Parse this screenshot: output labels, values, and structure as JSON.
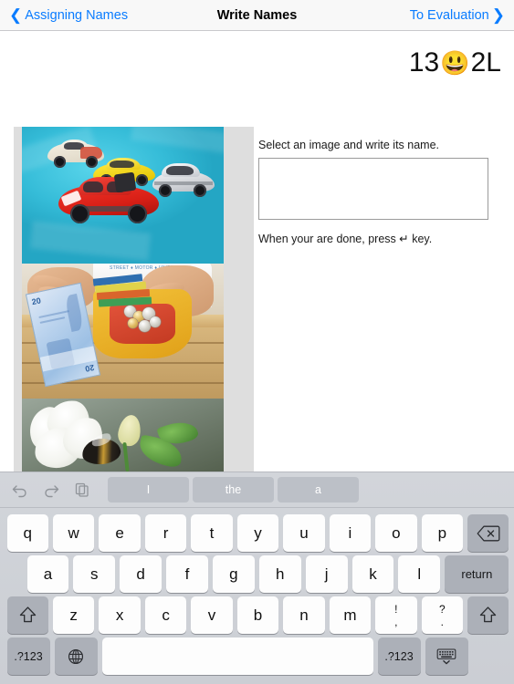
{
  "navbar": {
    "back_label": "Assigning Names",
    "back_icon": "chevron-left-icon",
    "title": "Write Names",
    "forward_label": "To Evaluation",
    "forward_icon": "chevron-right-icon",
    "link_color": "#0a7cff"
  },
  "score": {
    "correct": "13",
    "emoji": "😃",
    "lives": "2L"
  },
  "images": [
    {
      "name": "toy-cars-photo",
      "alt": "Four toy cars on a blue cloth"
    },
    {
      "name": "wallet-money-photo",
      "alt": "Hand holding a 20 euro note next to a yellow wallet with coins"
    },
    {
      "name": "flower-bee-photo",
      "alt": "White hibiscus flower with a bumblebee"
    }
  ],
  "instructions": {
    "top": "Select an image and write its name.",
    "answer_value": "",
    "answer_placeholder": "",
    "bottom_before": "When your are done, press ",
    "bottom_key": "↵",
    "bottom_after": " key."
  },
  "keyboard": {
    "suggestion_icons": [
      {
        "name": "undo-icon"
      },
      {
        "name": "redo-icon"
      },
      {
        "name": "paste-icon"
      }
    ],
    "suggestions": [
      "I",
      "the",
      "a"
    ],
    "row1": [
      "q",
      "w",
      "e",
      "r",
      "t",
      "y",
      "u",
      "i",
      "o",
      "p"
    ],
    "backspace_icon": "backspace-icon",
    "row2": [
      "a",
      "s",
      "d",
      "f",
      "g",
      "h",
      "j",
      "k",
      "l"
    ],
    "return_label": "return",
    "shift_icon": "shift-icon",
    "row3": [
      "z",
      "x",
      "c",
      "v",
      "b",
      "n",
      "m"
    ],
    "punct_keys": [
      {
        "up": "!",
        "down": ","
      },
      {
        "up": "?",
        "down": "."
      }
    ],
    "numeric_label": ".?123",
    "globe_icon": "globe-icon",
    "space_label": "",
    "hide_keyboard_icon": "hide-keyboard-icon"
  }
}
